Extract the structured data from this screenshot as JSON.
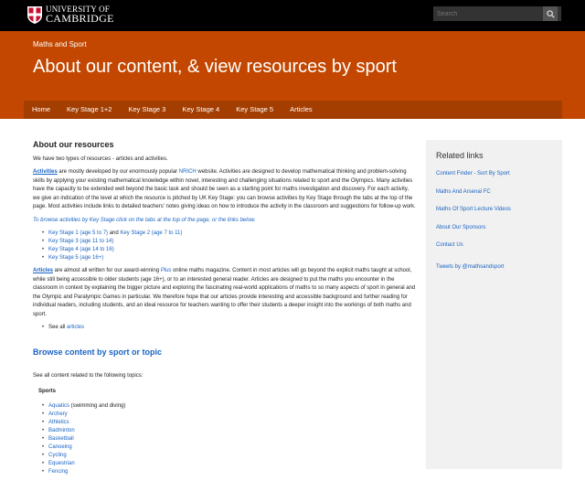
{
  "header": {
    "logo_line1": "UNIVERSITY OF",
    "logo_line2": "CAMBRIDGE",
    "search_placeholder": "Search"
  },
  "hero": {
    "breadcrumb": "Maths and Sport",
    "title": "About our content, & view resources by sport"
  },
  "nav": [
    "Home",
    "Key Stage 1+2",
    "Key Stage 3",
    "Key Stage 4",
    "Key Stage 5",
    "Articles"
  ],
  "main": {
    "heading": "About our resources",
    "intro": "We have two types of resources - articles and activities.",
    "activities_label": "Activities",
    "activities_p1": " are mostly developed by our enormously popular ",
    "nrich_link": "NRICH",
    "activities_p2": " website. Activities are designed to develop mathematical thinking and problem-solving skills by applying your existing mathematical knowledge within novel, interesting and challenging situations related to sport and the Olympics. Many activities have the capacity to be extended well beyond the basic task and should be seen as a starting point for maths investigation and discovery. For each activity, we give an indication of the level at which the resource is pitched by UK Key Stage: you can browse activities by Key Stage through the tabs at the top of the page. Most activities include links to detailed teachers' notes giving ideas on how to introduce the activity in the classroom and suggestions for follow-up work.",
    "browse_note": "To browse activities by Key Stage click on the tabs at the top of the page, or the links below.",
    "ks_links": [
      {
        "a": "Key Stage 1 (age 5 to 7)",
        "mid": " and ",
        "b": "Key Stage 2 (age 7 to 11)"
      },
      {
        "a": "Key Stage 3 (age 11 to 14)"
      },
      {
        "a": "Key Stage 4 (age 14 to 16)"
      },
      {
        "a": "Key Stage 5 (age 16+)"
      }
    ],
    "articles_label": "Articles",
    "articles_p1": " are almost all written for our award-winning ",
    "plus_link": "Plus",
    "articles_p2": " online maths magazine. Content in most articles will go beyond the explicit maths taught at school, while still being accessible to older students (age 16+), or to an interested general reader. Articles are designed to put the maths you encounter in the classroom in context by explaining the bigger picture and exploring the fascinating real-world applications of maths to so many aspects of sport in general and the Olympic and Paralympic Games in particular. We therefore hope that our articles provide interesting and accessible background and further reading for individual readers, including students, and an ideal resource for teachers wanting to offer their students a deeper insight into the workings of both maths and sport.",
    "see_all_prefix": "See all ",
    "see_all_link": "articles",
    "browse_heading": "Browse content by sport or topic",
    "see_all_topics": "See all content related to the following topics:",
    "sports_heading": "Sports",
    "sports": [
      {
        "name": "Aquatics",
        "suffix": " (swimming and diving)"
      },
      {
        "name": "Archery",
        "suffix": ""
      },
      {
        "name": "Athletics",
        "suffix": ""
      },
      {
        "name": "Badminton",
        "suffix": ""
      },
      {
        "name": "Basketball",
        "suffix": ""
      },
      {
        "name": "Canoeing",
        "suffix": ""
      },
      {
        "name": "Cycling",
        "suffix": ""
      },
      {
        "name": "Equestrian",
        "suffix": ""
      },
      {
        "name": "Fencing",
        "suffix": ""
      }
    ]
  },
  "sidebar": {
    "heading": "Related links",
    "links": [
      "Content Finder - Sort By Sport",
      "Maths And Arsenal FC",
      "Maths Of Sport Lecture Videos",
      "About Our Sponsors",
      "Contact Us"
    ],
    "tweets": "Tweets by @mathsandsport"
  },
  "colors": {
    "hero": "#c34700",
    "nav": "#a33d00",
    "link": "#1a64c2"
  }
}
